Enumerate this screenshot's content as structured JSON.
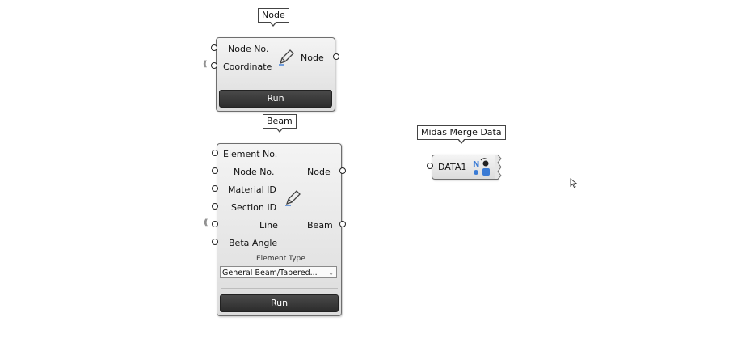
{
  "node_component": {
    "title": "Node",
    "inputs": [
      "Node No.",
      "Coordinate"
    ],
    "output": "Node",
    "run_label": "Run",
    "icon": "pencil-icon"
  },
  "beam_component": {
    "title": "Beam",
    "inputs": [
      "Element No.",
      "Node No.",
      "Material ID",
      "Section ID",
      "Line",
      "Beta Angle"
    ],
    "outputs": [
      "Node",
      "Beam"
    ],
    "element_type_label": "Element Type",
    "element_type_value": "General Beam/Tapered...",
    "run_label": "Run",
    "icon": "pencil-icon"
  },
  "merge_component": {
    "title": "Midas Merge Data",
    "input": "DATA1",
    "icon": "midas-merge-icon"
  }
}
